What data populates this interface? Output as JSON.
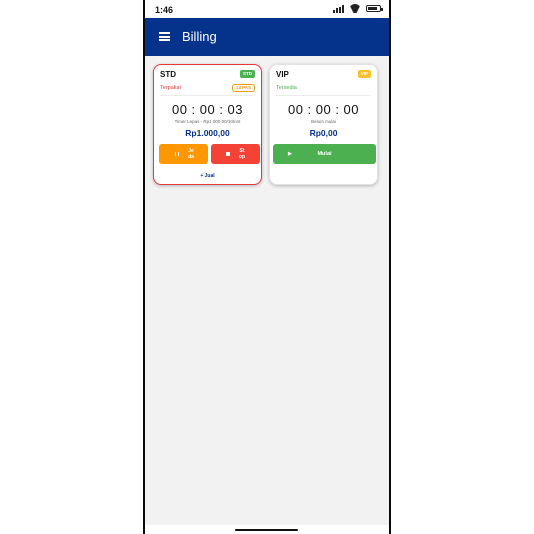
{
  "status_bar": {
    "time": "1:46",
    "battery_level": 0.85
  },
  "app_bar": {
    "title": "Billing",
    "menu_icon": "hamburger-menu-icon"
  },
  "cards": [
    {
      "name": "STD",
      "badge": "STD",
      "badge_color": "#4caf50",
      "state": "Terpakai",
      "mode": "LEPAS",
      "timer": "00 : 00 : 03",
      "note": "Timer Lepas - Rp1.000,00/10mnt",
      "price": "Rp1.000,00",
      "pause_label": "Je da",
      "stop_label": "St op",
      "sell_label": "+ Jual",
      "selected": true
    },
    {
      "name": "VIP",
      "badge": "VIP",
      "badge_color": "#fbc02d",
      "state": "Tersedia",
      "timer": "00 : 00 : 00",
      "note": "Belum mulai",
      "price": "Rp0,00",
      "start_label": "Mulai",
      "selected": false
    }
  ],
  "colors": {
    "primary": "#05338c",
    "danger": "#f44336",
    "warning": "#ff9800",
    "success": "#4caf50"
  }
}
